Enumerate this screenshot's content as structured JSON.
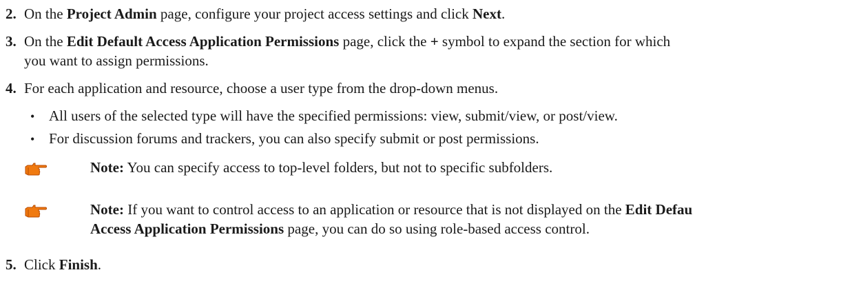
{
  "steps": {
    "s2": {
      "number": "2.",
      "t1": "On the ",
      "b1": "Project Admin",
      "t2": " page, configure your project access settings and click ",
      "b2": "Next",
      "t3": "."
    },
    "s3": {
      "number": "3.",
      "t1": "On the ",
      "b1": "Edit Default Access Application Permissions",
      "t2": " page, click the ",
      "b2": "+",
      "t3": " symbol to expand the section for which",
      "line2": "you want to assign permissions."
    },
    "s4": {
      "number": "4.",
      "text": "For each application and resource, choose a user type from the drop-down menus.",
      "bullets": [
        "All users of the selected type will have the specified permissions: view, submit/view, or post/view.",
        "For discussion forums and trackers, you can also specify submit or post permissions."
      ],
      "bullet_glyph": "•",
      "notes": [
        {
          "label": "Note:",
          "text": " You can specify access to top-level folders, but not to specific subfolders."
        },
        {
          "label": "Note:",
          "t1": " If you want to control access to an application or resource that is not displayed on the ",
          "b1": "Edit Defau",
          "b2": "Access Application Permissions",
          "t2": " page, you can do so using role-based access control."
        }
      ]
    },
    "s5": {
      "number": "5.",
      "t1": "Click ",
      "b1": "Finish",
      "t2": "."
    }
  },
  "colors": {
    "text": "#1a1a1a",
    "note_icon": "#f07a10",
    "note_icon_dark": "#b84a00"
  },
  "icons": {
    "note": "pointing-hand-icon"
  }
}
